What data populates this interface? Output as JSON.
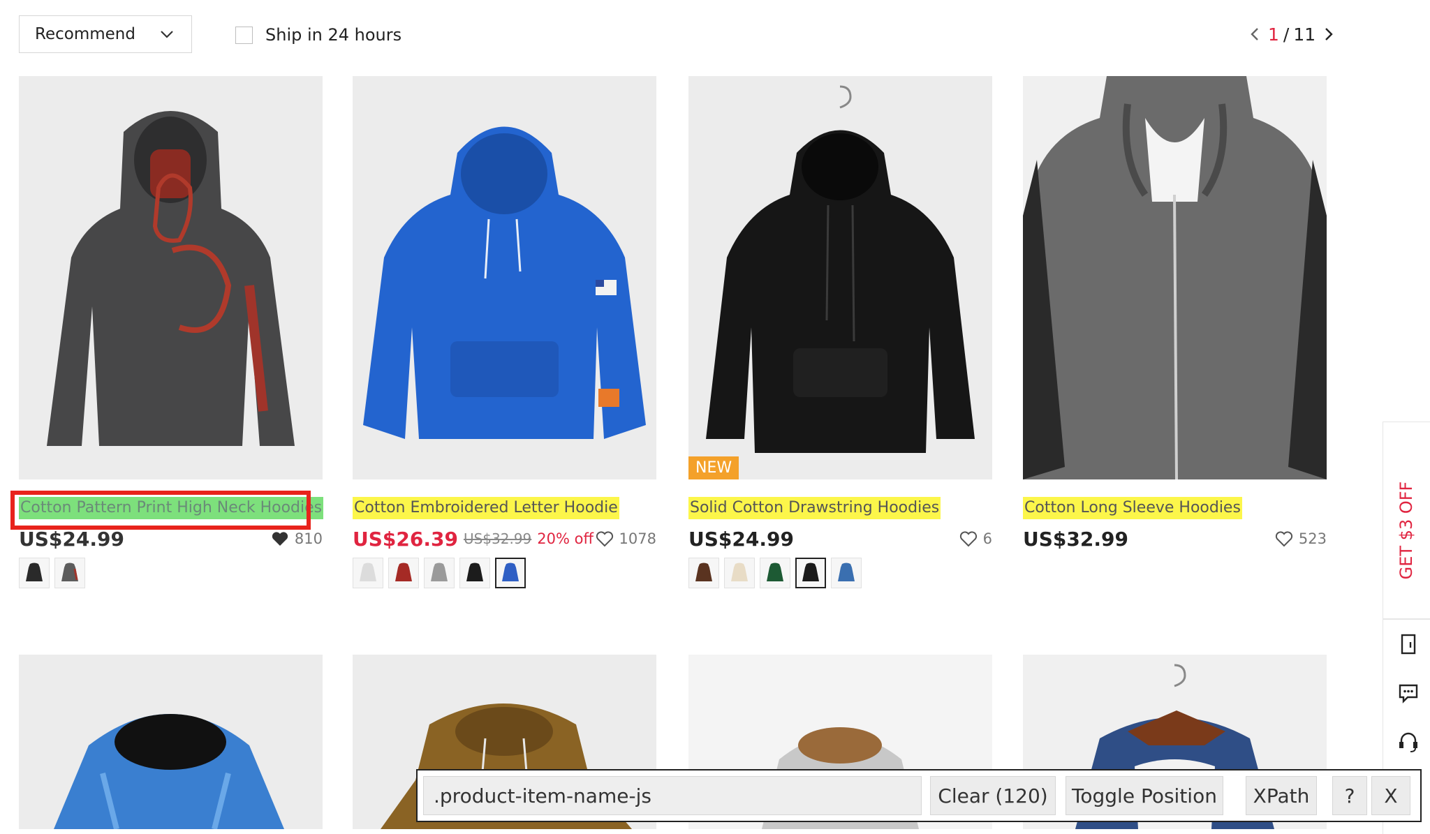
{
  "toolbar": {
    "sort_value": "Recommend",
    "ship_filter_label": "Ship in 24 hours",
    "pager_current": "1",
    "pager_separator": "/",
    "pager_total": "11"
  },
  "products": [
    {
      "name": "Cotton Pattern Print High Neck Hoodies",
      "price": "US$24.99",
      "likes": "810",
      "badge": "",
      "swatch_colors": [
        "#2a2a2a",
        "#5c5c5c"
      ],
      "active_swatch": 0
    },
    {
      "name": "Cotton Embroidered Letter Hoodie",
      "price": "US$26.39",
      "original_price": "US$32.99",
      "discount": "20% off",
      "likes": "1078",
      "badge": "",
      "swatch_colors": [
        "#dcdcdc",
        "#a52a25",
        "#9a9a9a",
        "#1c1c1c",
        "#2f5fc4"
      ],
      "active_swatch": 4
    },
    {
      "name": "Solid Cotton Drawstring Hoodies",
      "price": "US$24.99",
      "likes": "6",
      "badge": "NEW",
      "swatch_colors": [
        "#5a3320",
        "#e8dcc6",
        "#1d5a34",
        "#1a1a1a",
        "#3a6fb0"
      ],
      "active_swatch": 3
    },
    {
      "name": "Cotton Long Sleeve Hoodies",
      "price": "US$32.99",
      "likes": "523",
      "badge": "",
      "swatch_colors": [],
      "active_swatch": -1
    }
  ],
  "side_bar": {
    "coupon_label": "GET $3 OFF",
    "icons": [
      "bookmark-icon",
      "chat-icon",
      "headset-icon"
    ]
  },
  "helper": {
    "selector_value": ".product-item-name-js",
    "clear_label": "Clear (120)",
    "toggle_label": "Toggle Position",
    "xpath_label": "XPath",
    "help_label": "?",
    "close_label": "X"
  },
  "colors": {
    "highlight_yellow": "#fcf64a",
    "highlight_green": "#7de07c",
    "selection_red": "#e8231c",
    "sale_red": "#e02440",
    "badge_orange": "#f4a12a"
  }
}
